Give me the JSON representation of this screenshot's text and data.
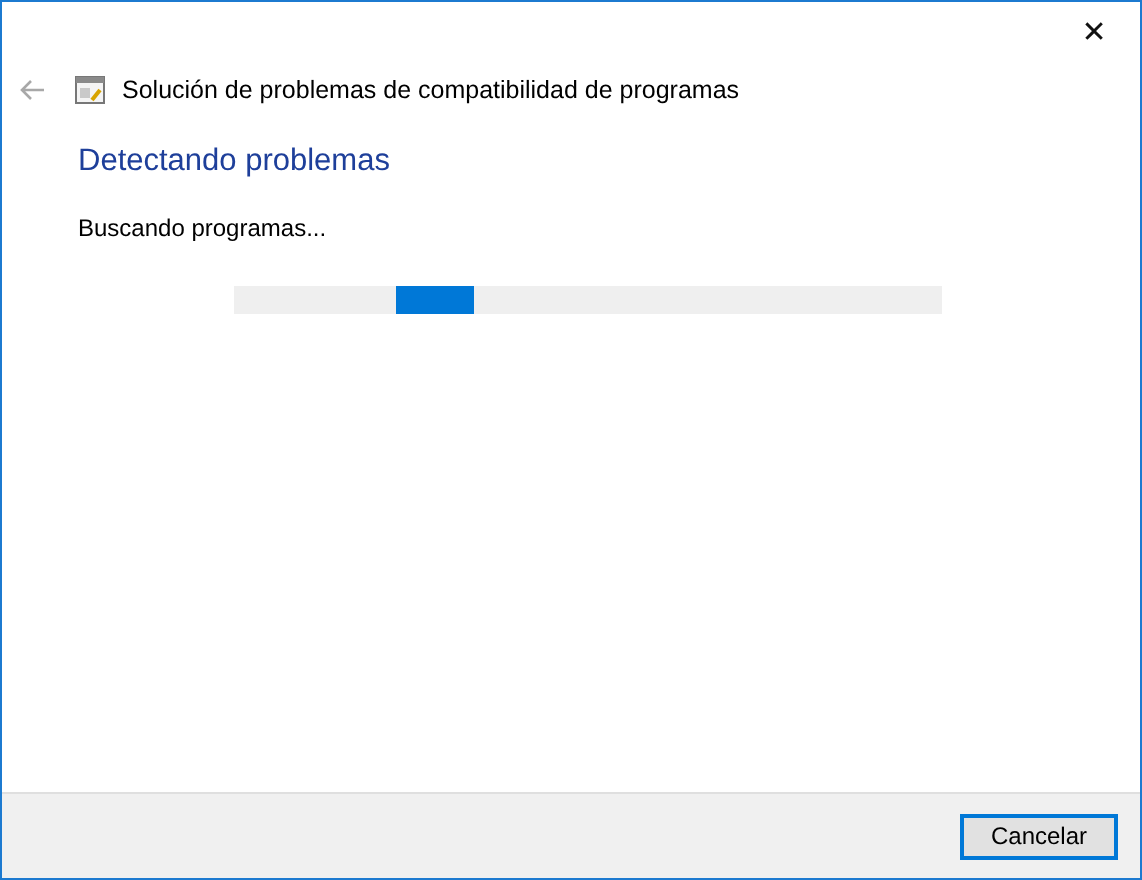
{
  "window": {
    "title": "Solución de problemas de compatibilidad de programas",
    "close": "✕"
  },
  "heading": "Detectando problemas",
  "status": "Buscando programas...",
  "progress": {
    "indeterminate": true
  },
  "buttons": [
    {
      "label": "Cancelar",
      "default": true
    }
  ]
}
